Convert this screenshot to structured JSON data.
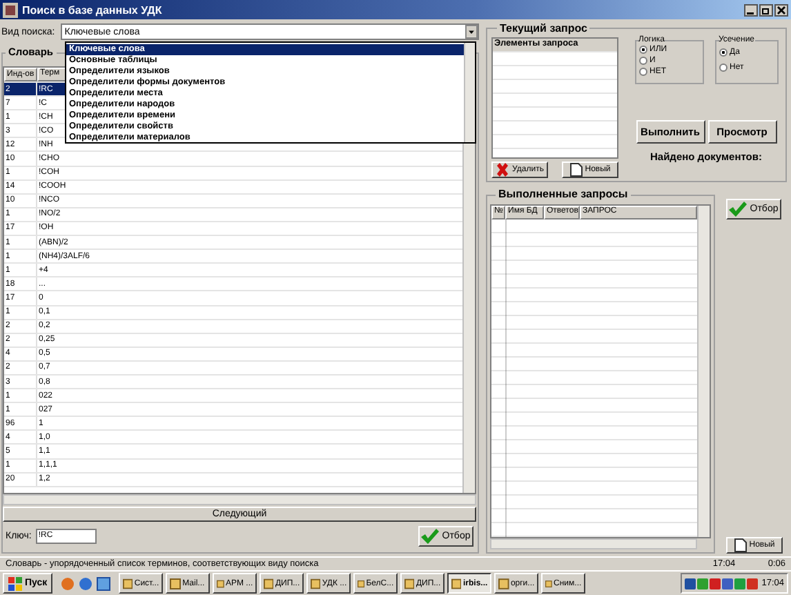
{
  "window": {
    "title": "Поиск в базе данных УДК"
  },
  "search_type": {
    "label": "Вид поиска:",
    "value": "Ключевые слова"
  },
  "dropdown": {
    "items": [
      {
        "label": "Ключевые слова",
        "selected": true
      },
      {
        "label": "Основные таблицы",
        "selected": false
      },
      {
        "label": "Определители языков",
        "selected": false
      },
      {
        "label": "Определители формы документов",
        "selected": false
      },
      {
        "label": "Определители места",
        "selected": false
      },
      {
        "label": "Определители народов",
        "selected": false
      },
      {
        "label": "Определители времени",
        "selected": false
      },
      {
        "label": "Определители свойств",
        "selected": false
      },
      {
        "label": "Определители материалов",
        "selected": false
      }
    ]
  },
  "dictionary": {
    "title": "Словарь",
    "columns": [
      "Инд-ов",
      "Терм"
    ],
    "rows": [
      {
        "count": "2",
        "term": "!RC",
        "selected": true
      },
      {
        "count": "7",
        "term": "!C",
        "selected": false
      },
      {
        "count": "1",
        "term": "!CH",
        "selected": false
      },
      {
        "count": "3",
        "term": "!CO",
        "selected": false
      },
      {
        "count": "12",
        "term": "!NH",
        "selected": false
      },
      {
        "count": "10",
        "term": "!CHO",
        "selected": false
      },
      {
        "count": "1",
        "term": "!COH",
        "selected": false
      },
      {
        "count": "14",
        "term": "!COOH",
        "selected": false
      },
      {
        "count": "10",
        "term": "!NCO",
        "selected": false
      },
      {
        "count": "1",
        "term": "!NO/2",
        "selected": false
      },
      {
        "count": "17",
        "term": "!OH",
        "selected": false
      },
      {
        "count": "1",
        "term": "(ABN)/2",
        "selected": false
      },
      {
        "count": "1",
        "term": "(NH4)/3ALF/6",
        "selected": false
      },
      {
        "count": "1",
        "term": "+4",
        "selected": false
      },
      {
        "count": "18",
        "term": "...",
        "selected": false
      },
      {
        "count": "17",
        "term": "0",
        "selected": false
      },
      {
        "count": "1",
        "term": "0,1",
        "selected": false
      },
      {
        "count": "2",
        "term": "0,2",
        "selected": false
      },
      {
        "count": "2",
        "term": "0,25",
        "selected": false
      },
      {
        "count": "4",
        "term": "0,5",
        "selected": false
      },
      {
        "count": "2",
        "term": "0,7",
        "selected": false
      },
      {
        "count": "3",
        "term": "0,8",
        "selected": false
      },
      {
        "count": "1",
        "term": "022",
        "selected": false
      },
      {
        "count": "1",
        "term": "027",
        "selected": false
      },
      {
        "count": "96",
        "term": "1",
        "selected": false
      },
      {
        "count": "4",
        "term": "1,0",
        "selected": false
      },
      {
        "count": "5",
        "term": "1,1",
        "selected": false
      },
      {
        "count": "1",
        "term": "1,1,1",
        "selected": false
      },
      {
        "count": "20",
        "term": "1,2",
        "selected": false
      }
    ]
  },
  "next_button": "Следующий",
  "key": {
    "label": "Ключ:",
    "value": "!RC"
  },
  "filter_button": "Отбор",
  "current_query": {
    "title": "Текущий запрос",
    "list_header": "Элементы запроса",
    "delete_button": "Удалить",
    "new_button": "Новый"
  },
  "logic": {
    "title": "Логика",
    "options": [
      {
        "label": "ИЛИ",
        "selected": true
      },
      {
        "label": "И",
        "selected": false
      },
      {
        "label": "НЕТ",
        "selected": false
      }
    ]
  },
  "truncation": {
    "title": "Усечение",
    "options": [
      {
        "label": "Да",
        "selected": true
      },
      {
        "label": "Нет",
        "selected": false
      }
    ]
  },
  "run_button": "Выполнить",
  "view_button": "Просмотр",
  "found_label": "Найдено документов:",
  "done_queries": {
    "title": "Выполненные запросы",
    "columns": [
      "№",
      "Имя БД",
      "Ответов",
      "ЗАПРОС"
    ],
    "filter_button": "Отбор",
    "new_button": "Новый"
  },
  "status_bar": {
    "text": "Словарь - упорядоченный список терминов, соответствующих виду поиска",
    "time": "17:04",
    "elapsed": "0:06"
  },
  "taskbar": {
    "start": "Пуск",
    "tasks": [
      {
        "label": "Сист...",
        "selected": false
      },
      {
        "label": "Mail...",
        "selected": false
      },
      {
        "label": "АРМ ...",
        "selected": false
      },
      {
        "label": "ДИП...",
        "selected": false
      },
      {
        "label": "УДК ...",
        "selected": false
      },
      {
        "label": "БелС...",
        "selected": false
      },
      {
        "label": "ДИП...",
        "selected": false
      },
      {
        "label": "irbis...",
        "selected": true
      },
      {
        "label": "орги...",
        "selected": false
      },
      {
        "label": "Сним...",
        "selected": false
      }
    ],
    "clock": "17:04"
  }
}
